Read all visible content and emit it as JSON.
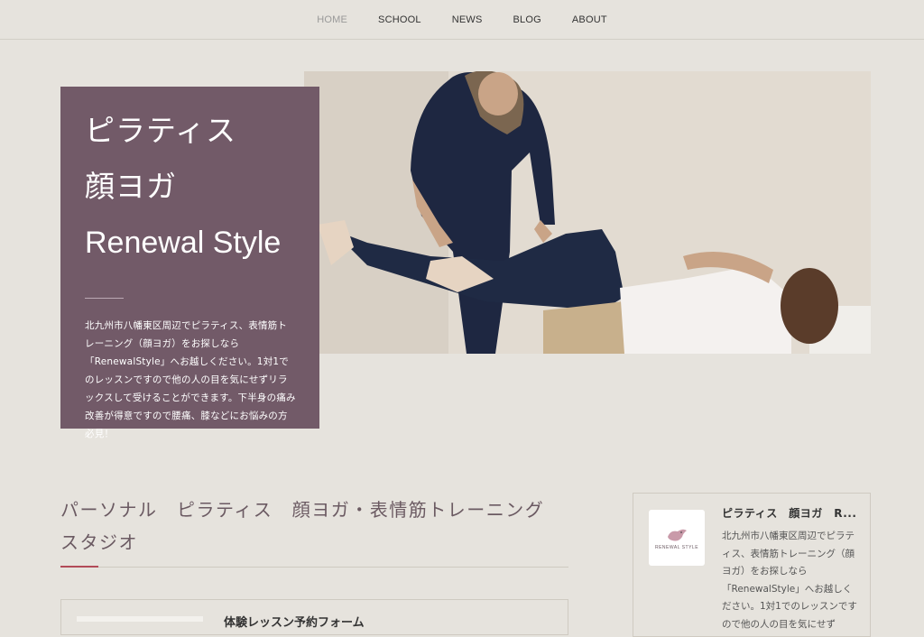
{
  "nav": {
    "items": [
      "HOME",
      "SCHOOL",
      "NEWS",
      "BLOG",
      "ABOUT"
    ],
    "active": "HOME"
  },
  "hero": {
    "title_line1": "ピラティス",
    "title_line2": "顔ヨガ",
    "title_line3": "Renewal Style",
    "description": "北九州市八幡東区周辺でピラティス、表情筋トレーニング（顔ヨガ）をお探しなら「RenewalStyle」へお越しください。1対1でのレッスンですので他の人の目を気にせずリラックスして受けることができます。下半身の痛み改善が得意ですので腰痛、膝などにお悩みの方必見！",
    "box_color": "#725a68"
  },
  "section": {
    "title": "パーソナル　ピラティス　顔ヨガ・表情筋トレーニング　スタジオ",
    "accent_color": "#b24b58",
    "card_title": "体験レッスン予約フォーム"
  },
  "sidebar": {
    "title": "ピラティス　顔ヨガ　R...",
    "description": "北九州市八幡東区周辺でピラティス、表情筋トレーニング（顔ヨガ）をお探しなら「RenewalStyle」へお越しください。1対1でのレッスンですので他の人の目を気にせず",
    "logo_text": "RENEWAL STYLE"
  },
  "colors": {
    "background": "#e6e3dd",
    "text": "#333333",
    "nav_active": "#999999"
  }
}
